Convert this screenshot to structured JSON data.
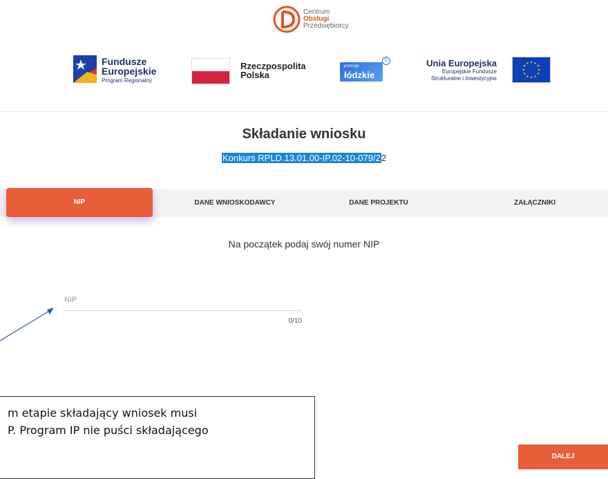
{
  "header": {
    "center_logo": {
      "line1": "Centrum",
      "line2": "Obsługi",
      "line3": "Przedsiębiorcy"
    },
    "logos": {
      "fundusze": {
        "line1": "Fundusze",
        "line2": "Europejskie",
        "line3": "Program Regionalny"
      },
      "rp": {
        "line1": "Rzeczpospolita",
        "line2": "Polska"
      },
      "lodzkie": {
        "small": "promuje",
        "big": "łódzkie",
        "mark": "©"
      },
      "ue": {
        "line1": "Unia Europejska",
        "line2": "Europejskie Fundusze",
        "line3": "Strukturalne i Inwestycyjne"
      }
    }
  },
  "page": {
    "title": "Składanie wniosku",
    "subtitle_selected": "Konkurs RPLD.13.01.00-IP.02-10-079/2",
    "subtitle_rest": "2"
  },
  "tabs": [
    {
      "label": "NIP",
      "active": true
    },
    {
      "label": "DANE WNIOSKODAWCY",
      "active": false
    },
    {
      "label": "DANE PROJEKTU",
      "active": false
    },
    {
      "label": "ZAŁĄCZNIKI",
      "active": false
    }
  ],
  "prompt": "Na początek podaj swój numer NIP",
  "nip_field": {
    "label": "NIP",
    "value": "",
    "counter": "0/10"
  },
  "callout": {
    "line1": "m etapie składający wniosek musi",
    "line2": "P. Program IP nie puści składającego"
  },
  "next_button": {
    "label": "DALEJ"
  },
  "colors": {
    "accent": "#e85d3a",
    "selection": "#1d86d8",
    "tab_bar": "#f3f3f3",
    "arrow": "#2f5d9e"
  }
}
